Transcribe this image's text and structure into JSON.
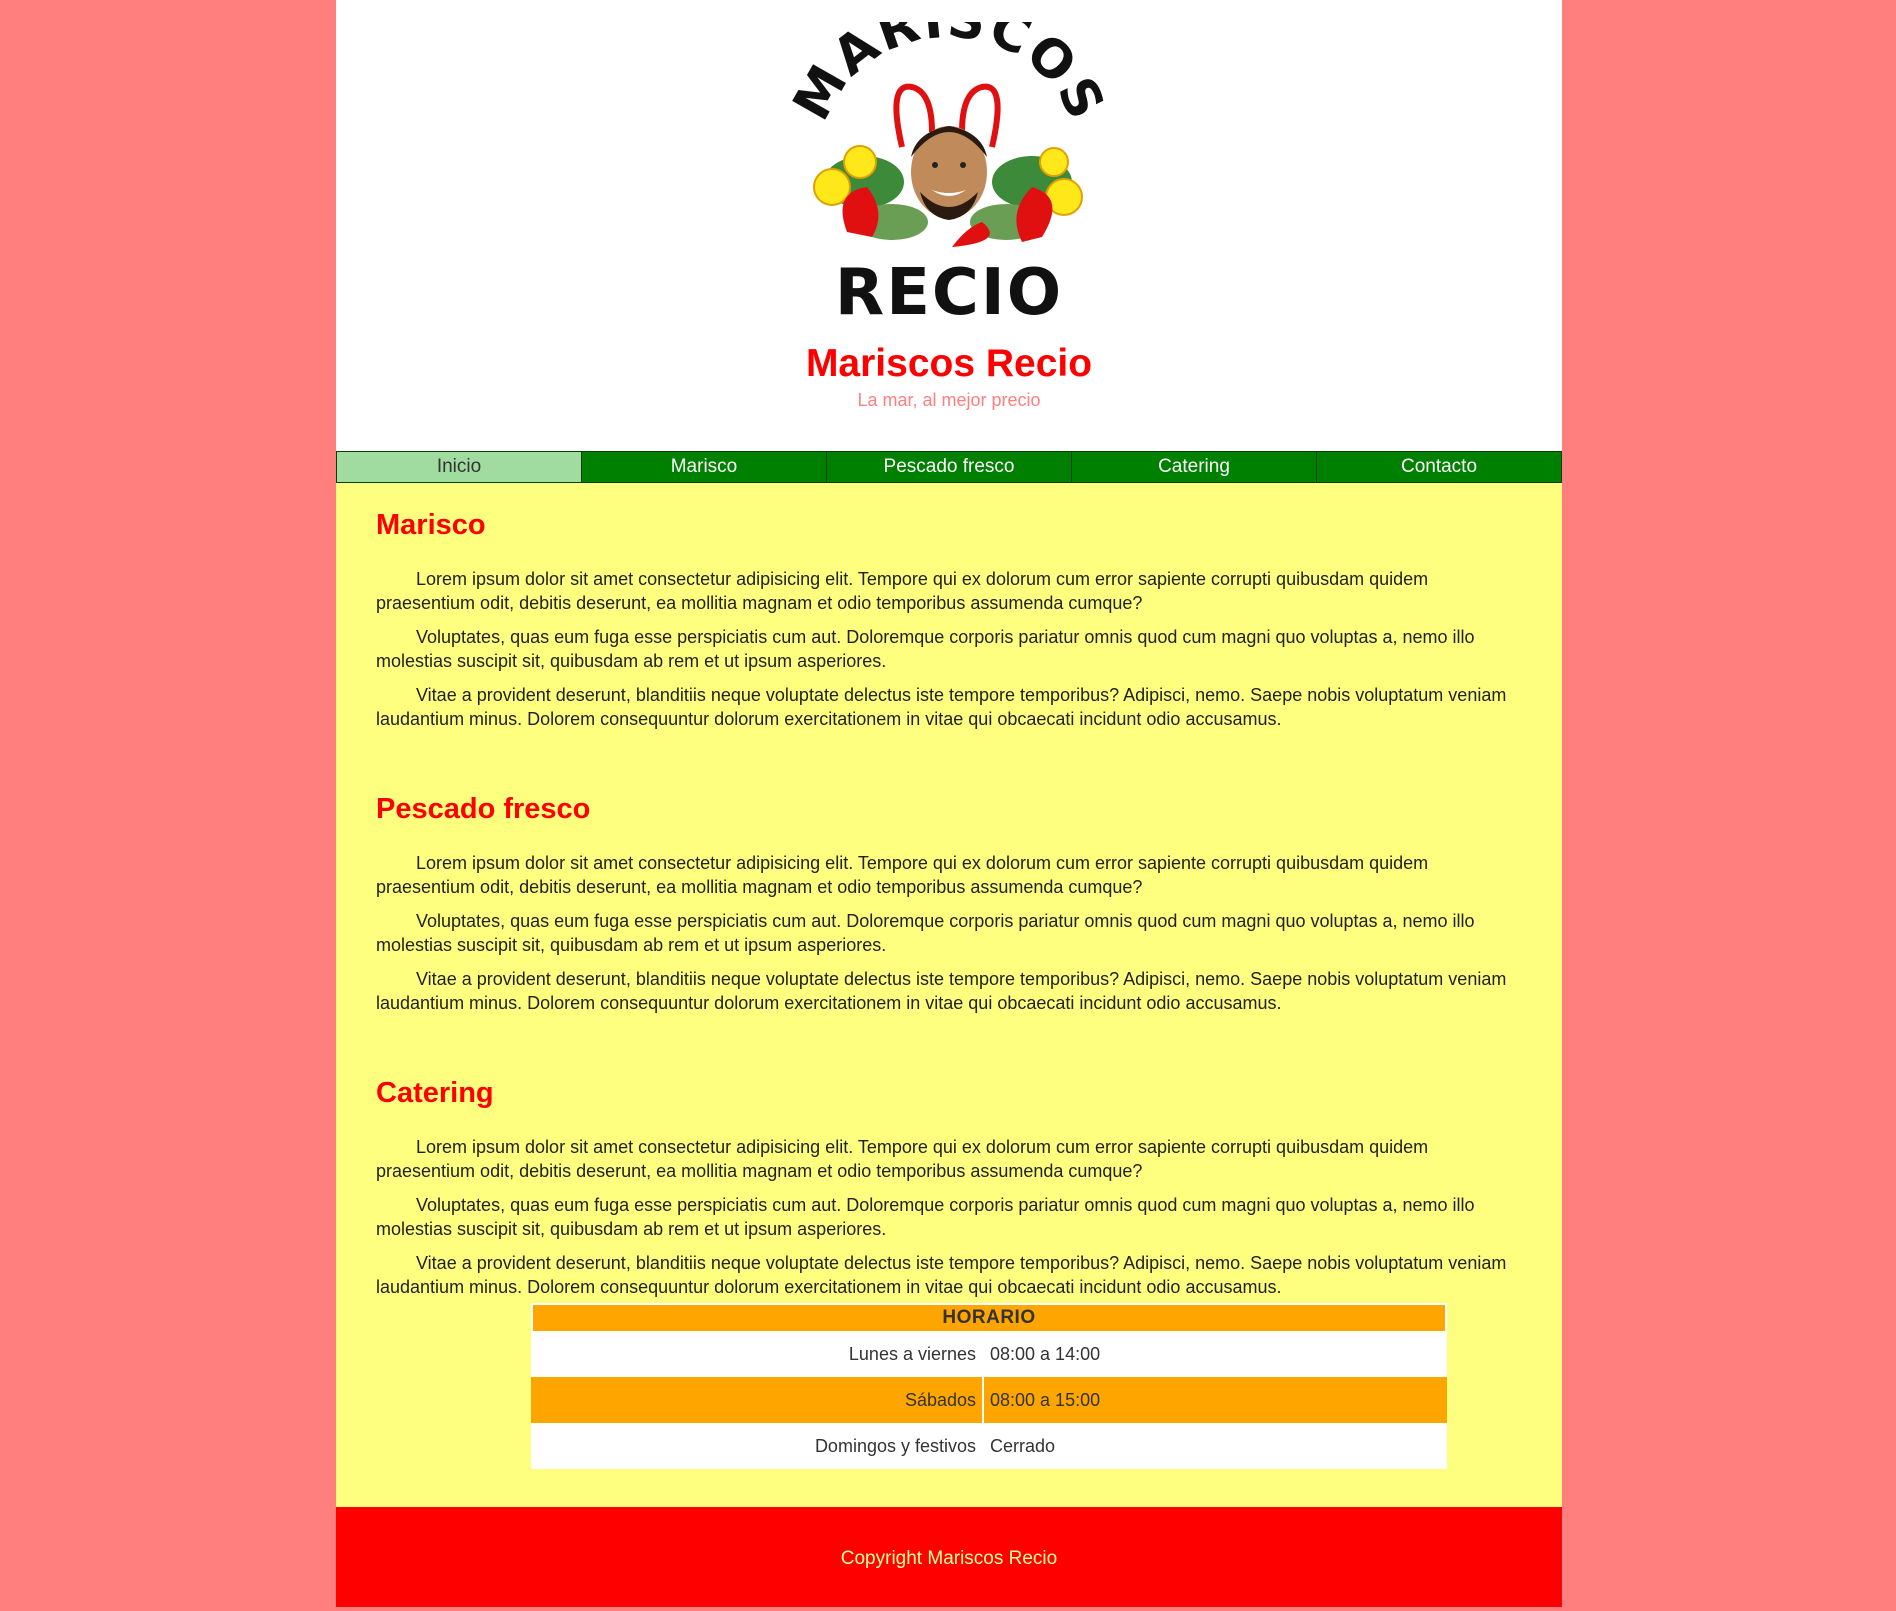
{
  "header": {
    "logo_text_top": "MARISCOS",
    "logo_text_bottom": "RECIO",
    "title": "Mariscos Recio",
    "tagline": "La mar, al mejor precio"
  },
  "nav": {
    "items": [
      {
        "label": "Inicio",
        "active": true
      },
      {
        "label": "Marisco",
        "active": false
      },
      {
        "label": "Pescado fresco",
        "active": false
      },
      {
        "label": "Catering",
        "active": false
      },
      {
        "label": "Contacto",
        "active": false
      }
    ]
  },
  "sections": [
    {
      "heading": "Marisco",
      "paragraphs": [
        "Lorem ipsum dolor sit amet consectetur adipisicing elit. Tempore qui ex dolorum cum error sapiente corrupti quibusdam quidem praesentium odit, debitis deserunt, ea mollitia magnam et odio temporibus assumenda cumque?",
        "Voluptates, quas eum fuga esse perspiciatis cum aut. Doloremque corporis pariatur omnis quod cum magni quo voluptas a, nemo illo molestias suscipit sit, quibusdam ab rem et ut ipsum asperiores.",
        "Vitae a provident deserunt, blanditiis neque voluptate delectus iste tempore temporibus? Adipisci, nemo. Saepe nobis voluptatum veniam laudantium minus. Dolorem consequuntur dolorum exercitationem in vitae qui obcaecati incidunt odio accusamus."
      ]
    },
    {
      "heading": "Pescado fresco",
      "paragraphs": [
        "Lorem ipsum dolor sit amet consectetur adipisicing elit. Tempore qui ex dolorum cum error sapiente corrupti quibusdam quidem praesentium odit, debitis deserunt, ea mollitia magnam et odio temporibus assumenda cumque?",
        "Voluptates, quas eum fuga esse perspiciatis cum aut. Doloremque corporis pariatur omnis quod cum magni quo voluptas a, nemo illo molestias suscipit sit, quibusdam ab rem et ut ipsum asperiores.",
        "Vitae a provident deserunt, blanditiis neque voluptate delectus iste tempore temporibus? Adipisci, nemo. Saepe nobis voluptatum veniam laudantium minus. Dolorem consequuntur dolorum exercitationem in vitae qui obcaecati incidunt odio accusamus."
      ]
    },
    {
      "heading": "Catering",
      "paragraphs": [
        "Lorem ipsum dolor sit amet consectetur adipisicing elit. Tempore qui ex dolorum cum error sapiente corrupti quibusdam quidem praesentium odit, debitis deserunt, ea mollitia magnam et odio temporibus assumenda cumque?",
        "Voluptates, quas eum fuga esse perspiciatis cum aut. Doloremque corporis pariatur omnis quod cum magni quo voluptas a, nemo illo molestias suscipit sit, quibusdam ab rem et ut ipsum asperiores.",
        "Vitae a provident deserunt, blanditiis neque voluptate delectus iste tempore temporibus? Adipisci, nemo. Saepe nobis voluptatum veniam laudantium minus. Dolorem consequuntur dolorum exercitationem in vitae qui obcaecati incidunt odio accusamus."
      ]
    }
  ],
  "schedule": {
    "title": "HORARIO",
    "rows": [
      {
        "day": "Lunes a viernes",
        "hours": "08:00 a 14:00"
      },
      {
        "day": "Sábados",
        "hours": "08:00 a 15:00"
      },
      {
        "day": "Domingos y festivos",
        "hours": "Cerrado"
      }
    ]
  },
  "footer": {
    "copyright": "Copyright Mariscos Recio"
  },
  "colors": {
    "page_background": "#ff7f7f",
    "content_background": "#ffff7f",
    "heading": "#ff0000",
    "nav": "#008000",
    "nav_active": "#a0dca0",
    "schedule_accent": "#ffa500",
    "footer": "#ff0000"
  }
}
